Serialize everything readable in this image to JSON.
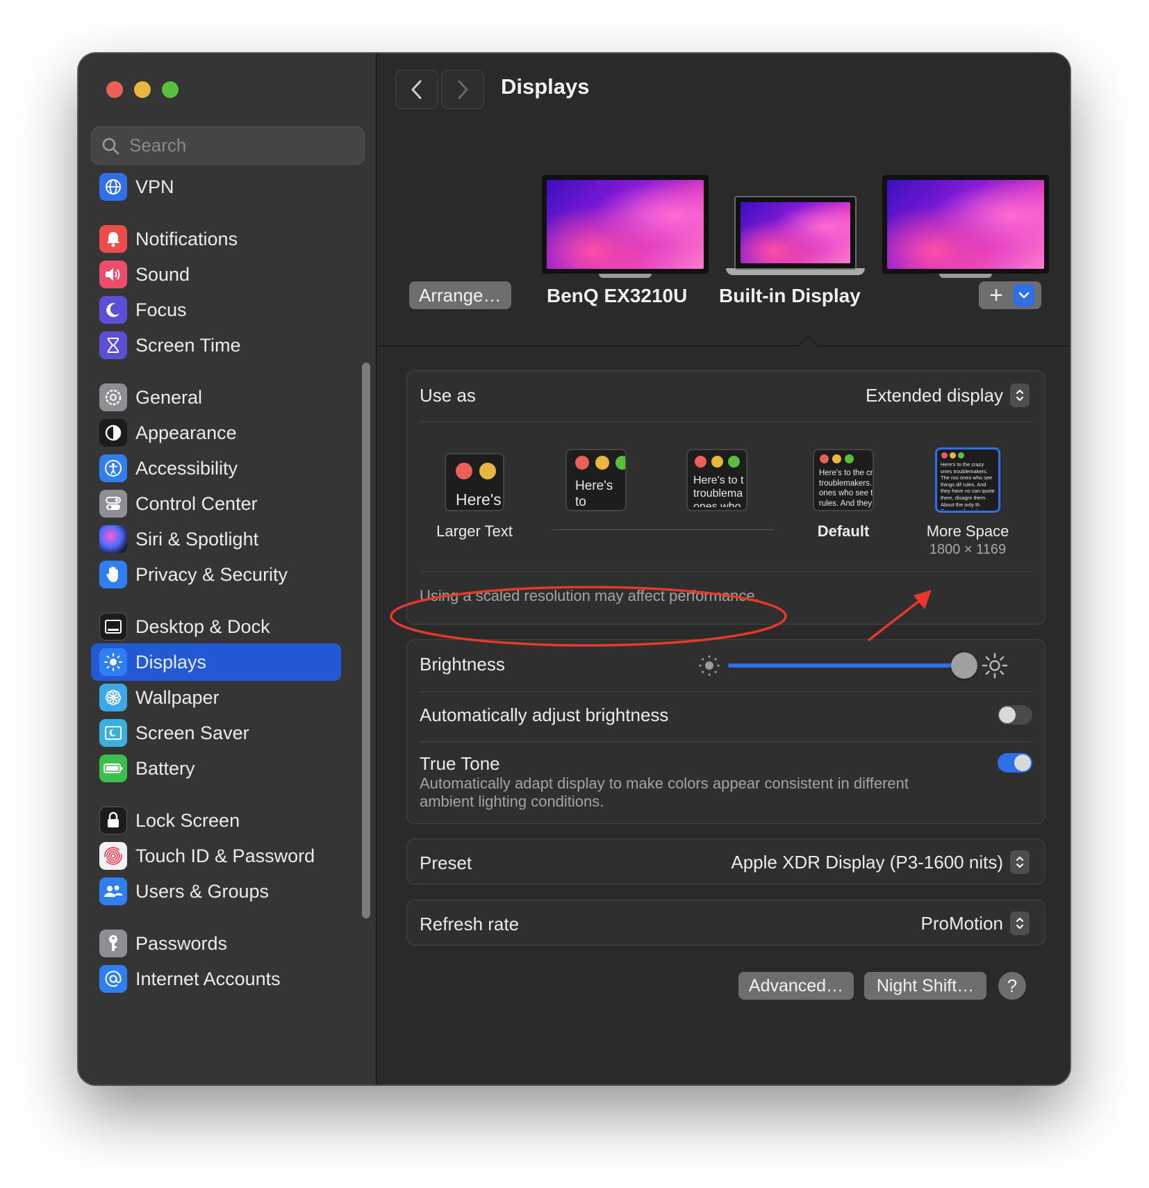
{
  "window": {
    "title": "Displays"
  },
  "search": {
    "placeholder": "Search"
  },
  "sidebar": {
    "items": [
      {
        "label": "VPN",
        "icon": "globe-icon",
        "color": "#2f6fe8"
      },
      {
        "label": "Notifications",
        "icon": "bell-icon",
        "color": "#ec4d4a"
      },
      {
        "label": "Sound",
        "icon": "speaker-icon",
        "color": "#ec4d6a"
      },
      {
        "label": "Focus",
        "icon": "moon-icon",
        "color": "#5b4fd6"
      },
      {
        "label": "Screen Time",
        "icon": "hourglass-icon",
        "color": "#5b4fd6"
      },
      {
        "label": "General",
        "icon": "gear-icon",
        "color": "#8e8e93"
      },
      {
        "label": "Appearance",
        "icon": "appearance-icon",
        "color": "#1c1c1c"
      },
      {
        "label": "Accessibility",
        "icon": "accessibility-icon",
        "color": "#2f7ff0"
      },
      {
        "label": "Control Center",
        "icon": "toggles-icon",
        "color": "#8e8e93"
      },
      {
        "label": "Siri & Spotlight",
        "icon": "siri-icon",
        "color": "#2a2a5a"
      },
      {
        "label": "Privacy & Security",
        "icon": "hand-icon",
        "color": "#2f7ff0"
      },
      {
        "label": "Desktop & Dock",
        "icon": "dock-icon",
        "color": "#1c1c1c"
      },
      {
        "label": "Displays",
        "icon": "sun-icon",
        "color": "#2f7ff0"
      },
      {
        "label": "Wallpaper",
        "icon": "flower-icon",
        "color": "#3ba8e8"
      },
      {
        "label": "Screen Saver",
        "icon": "screensaver-icon",
        "color": "#3ab0e0"
      },
      {
        "label": "Battery",
        "icon": "battery-icon",
        "color": "#3cbf4e"
      },
      {
        "label": "Lock Screen",
        "icon": "lock-icon",
        "color": "#1c1c1c"
      },
      {
        "label": "Touch ID & Password",
        "icon": "fingerprint-icon",
        "color": "#f2f2f2"
      },
      {
        "label": "Users & Groups",
        "icon": "users-icon",
        "color": "#2f7ff0"
      },
      {
        "label": "Passwords",
        "icon": "key-icon",
        "color": "#8e8e93"
      },
      {
        "label": "Internet Accounts",
        "icon": "at-icon",
        "color": "#2f7ff0"
      }
    ],
    "selected": "Displays"
  },
  "header": {
    "title": "Displays",
    "back": "Back",
    "forward": "Forward"
  },
  "displays": {
    "arrange_label": "Arrange…",
    "monitors": [
      {
        "label": "BenQ EX3210U"
      },
      {
        "label": "Built-in Display",
        "selected": true
      },
      {
        "label": ""
      }
    ],
    "add_label": "+"
  },
  "use_as": {
    "label": "Use as",
    "value": "Extended display"
  },
  "resolution": {
    "options": [
      {
        "caption": "Larger Text",
        "sample": "Here's"
      },
      {
        "caption": "",
        "sample": "Here's to troublem"
      },
      {
        "caption": "",
        "sample": "Here's to t troublema ones who"
      },
      {
        "caption": "Default",
        "sample": "Here's to the cr troublemakers. ones who see t rules. And they"
      },
      {
        "caption": "More Space",
        "sub": "1800 × 1169",
        "sample": "Here's to the crazy ones troublemakers. The rou ones who see things dif rules. And they have no can quote them, disagre them. About the only th Because they change th",
        "selected": true
      }
    ],
    "warning": "Using a scaled resolution may affect performance."
  },
  "brightness": {
    "label": "Brightness",
    "value": 0.97
  },
  "auto_brightness": {
    "label": "Automatically adjust brightness",
    "on": false
  },
  "true_tone": {
    "label": "True Tone",
    "description_1": "Automatically adapt display to make colors appear consistent in different",
    "description_2": "ambient lighting conditions.",
    "on": true
  },
  "preset": {
    "label": "Preset",
    "value": "Apple XDR Display (P3-1600 nits)"
  },
  "refresh": {
    "label": "Refresh rate",
    "value": "ProMotion"
  },
  "footer": {
    "advanced": "Advanced…",
    "night_shift": "Night Shift…",
    "help": "?"
  },
  "colors": {
    "accent": "#2f6fe8",
    "selected_row": "#2459d6",
    "annotation": "#e8382b"
  }
}
